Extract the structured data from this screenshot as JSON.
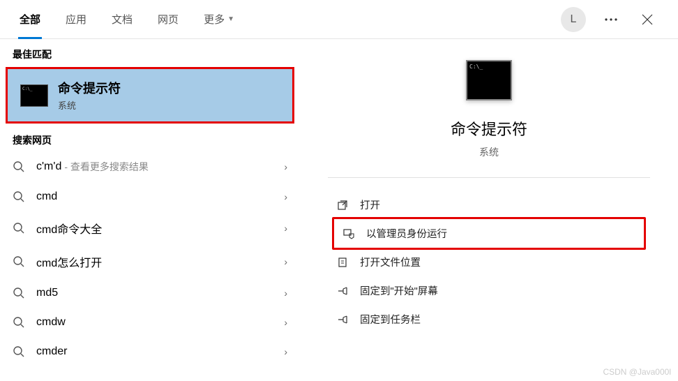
{
  "header": {
    "tabs": [
      {
        "label": "全部",
        "active": true
      },
      {
        "label": "应用",
        "active": false
      },
      {
        "label": "文档",
        "active": false
      },
      {
        "label": "网页",
        "active": false
      },
      {
        "label": "更多",
        "active": false,
        "more": true
      }
    ],
    "avatar_initial": "L"
  },
  "left": {
    "best_match_heading": "最佳匹配",
    "best_match": {
      "title": "命令提示符",
      "subtitle": "系统"
    },
    "web_heading": "搜索网页",
    "web_items": [
      {
        "text": "c'm'd",
        "suffix": " - 查看更多搜索结果"
      },
      {
        "text": "cmd",
        "suffix": ""
      },
      {
        "text": "cmd命令大全",
        "suffix": ""
      },
      {
        "text": "cmd怎么打开",
        "suffix": ""
      },
      {
        "text": "md5",
        "suffix": ""
      },
      {
        "text": "cmdw",
        "suffix": ""
      },
      {
        "text": "cmder",
        "suffix": ""
      }
    ]
  },
  "right": {
    "title": "命令提示符",
    "subtitle": "系统",
    "actions": [
      {
        "label": "打开",
        "icon": "open-icon",
        "highlight": false
      },
      {
        "label": "以管理员身份运行",
        "icon": "admin-icon",
        "highlight": true
      },
      {
        "label": "打开文件位置",
        "icon": "folder-icon",
        "highlight": false
      },
      {
        "label": "固定到\"开始\"屏幕",
        "icon": "pin-icon",
        "highlight": false
      },
      {
        "label": "固定到任务栏",
        "icon": "pin-icon",
        "highlight": false
      }
    ]
  },
  "watermark": "CSDN @Java000l"
}
